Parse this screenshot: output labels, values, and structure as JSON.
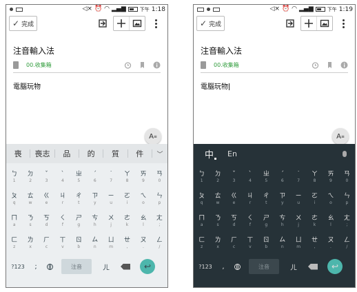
{
  "phones": [
    {
      "status": {
        "ampm": "下午",
        "time": "1:18"
      },
      "toolbar": {
        "done_label": "完成"
      },
      "note": {
        "title": "注音輸入法",
        "notebook": "00.收集箱",
        "body": "電腦玩物"
      },
      "format_label": "A",
      "keyboard": {
        "theme": "light",
        "candidates": [
          "喪",
          "喪志",
          "品",
          "的",
          "質",
          "件"
        ],
        "rows": [
          [
            {
              "m": "ㄅ",
              "s": "1"
            },
            {
              "m": "ㄉ",
              "s": "2"
            },
            {
              "m": "ˇ",
              "s": "3"
            },
            {
              "m": "ˋ",
              "s": "4"
            },
            {
              "m": "ㄓ",
              "s": "5"
            },
            {
              "m": "ˊ",
              "s": "6"
            },
            {
              "m": "˙",
              "s": "7"
            },
            {
              "m": "ㄚ",
              "s": "8"
            },
            {
              "m": "ㄞ",
              "s": "9"
            },
            {
              "m": "ㄢ",
              "s": "0"
            }
          ],
          [
            {
              "m": "ㄆ",
              "s": "q"
            },
            {
              "m": "ㄊ",
              "s": "w"
            },
            {
              "m": "ㄍ",
              "s": "e"
            },
            {
              "m": "ㄐ",
              "s": "r"
            },
            {
              "m": "ㄔ",
              "s": "t"
            },
            {
              "m": "ㄗ",
              "s": "y"
            },
            {
              "m": "ㄧ",
              "s": "u"
            },
            {
              "m": "ㄛ",
              "s": "i"
            },
            {
              "m": "ㄟ",
              "s": "o"
            },
            {
              "m": "ㄣ",
              "s": "p"
            }
          ],
          [
            {
              "m": "ㄇ",
              "s": "a"
            },
            {
              "m": "ㄋ",
              "s": "s"
            },
            {
              "m": "ㄎ",
              "s": "d"
            },
            {
              "m": "ㄑ",
              "s": "f"
            },
            {
              "m": "ㄕ",
              "s": "g"
            },
            {
              "m": "ㄘ",
              "s": "h"
            },
            {
              "m": "ㄨ",
              "s": "j"
            },
            {
              "m": "ㄜ",
              "s": "k"
            },
            {
              "m": "ㄠ",
              "s": "l"
            },
            {
              "m": "ㄤ",
              "s": ";"
            }
          ],
          [
            {
              "m": "ㄈ",
              "s": "z"
            },
            {
              "m": "ㄌ",
              "s": "x"
            },
            {
              "m": "ㄏ",
              "s": "c"
            },
            {
              "m": "ㄒ",
              "s": "v"
            },
            {
              "m": "ㄖ",
              "s": "b"
            },
            {
              "m": "ㄙ",
              "s": "n"
            },
            {
              "m": "ㄩ",
              "s": "m"
            },
            {
              "m": "ㄝ",
              "s": ","
            },
            {
              "m": "ㄡ",
              "s": "."
            },
            {
              "m": "ㄥ",
              "s": "/"
            }
          ]
        ],
        "bottom": {
          "symbols": "?123",
          "punct": ";",
          "space": "注音",
          "er": "ㄦ"
        }
      }
    },
    {
      "status": {
        "ampm": "下午",
        "time": "1:19"
      },
      "toolbar": {
        "done_label": "完成"
      },
      "note": {
        "title": "注音輸入法",
        "notebook": "00.收集箱",
        "body": "電腦玩物"
      },
      "format_label": "A",
      "keyboard": {
        "theme": "dark",
        "mode": {
          "zh": "中",
          "en": "En"
        },
        "rows": [
          [
            {
              "m": "ㄅ",
              "s": "1"
            },
            {
              "m": "ㄉ",
              "s": "2"
            },
            {
              "m": "ˇ",
              "s": "3"
            },
            {
              "m": "ˋ",
              "s": "4"
            },
            {
              "m": "ㄓ",
              "s": "5"
            },
            {
              "m": "ˊ",
              "s": "6"
            },
            {
              "m": "˙",
              "s": "7"
            },
            {
              "m": "ㄚ",
              "s": "8"
            },
            {
              "m": "ㄞ",
              "s": "9"
            },
            {
              "m": "ㄢ",
              "s": "0"
            }
          ],
          [
            {
              "m": "ㄆ",
              "s": "q"
            },
            {
              "m": "ㄊ",
              "s": "w"
            },
            {
              "m": "ㄍ",
              "s": "e"
            },
            {
              "m": "ㄐ",
              "s": "r"
            },
            {
              "m": "ㄔ",
              "s": "t"
            },
            {
              "m": "ㄗ",
              "s": "y"
            },
            {
              "m": "ㄧ",
              "s": "u"
            },
            {
              "m": "ㄛ",
              "s": "i"
            },
            {
              "m": "ㄟ",
              "s": "o"
            },
            {
              "m": "ㄣ",
              "s": "p"
            }
          ],
          [
            {
              "m": "ㄇ",
              "s": "a"
            },
            {
              "m": "ㄋ",
              "s": "s"
            },
            {
              "m": "ㄎ",
              "s": "d"
            },
            {
              "m": "ㄑ",
              "s": "f"
            },
            {
              "m": "ㄕ",
              "s": "g"
            },
            {
              "m": "ㄘ",
              "s": "h"
            },
            {
              "m": "ㄨ",
              "s": "j"
            },
            {
              "m": "ㄜ",
              "s": "k"
            },
            {
              "m": "ㄠ",
              "s": "l"
            },
            {
              "m": "ㄤ",
              "s": ";"
            }
          ],
          [
            {
              "m": "ㄈ",
              "s": "z"
            },
            {
              "m": "ㄌ",
              "s": "x"
            },
            {
              "m": "ㄏ",
              "s": "c"
            },
            {
              "m": "ㄒ",
              "s": "v"
            },
            {
              "m": "ㄖ",
              "s": "b"
            },
            {
              "m": "ㄙ",
              "s": "n"
            },
            {
              "m": "ㄩ",
              "s": "m"
            },
            {
              "m": "ㄝ",
              "s": ","
            },
            {
              "m": "ㄡ",
              "s": "."
            },
            {
              "m": "ㄥ",
              "s": "/"
            }
          ]
        ],
        "bottom": {
          "symbols": "?123",
          "punct": ",",
          "space": "注音",
          "er": "ㄦ"
        }
      }
    }
  ],
  "colors": {
    "accent_green": "#2e9b3a",
    "enter_teal": "#4db6ac",
    "dark_kb": "#263238",
    "light_kb": "#eceff1"
  },
  "icons": [
    "check-icon",
    "reply-icon",
    "plus-icon",
    "image-icon",
    "more-vert-icon",
    "notebook-icon",
    "alarm-icon",
    "tag-icon",
    "info-icon",
    "globe-icon",
    "delete-icon",
    "enter-icon",
    "mic-icon",
    "chevron-down-icon"
  ]
}
